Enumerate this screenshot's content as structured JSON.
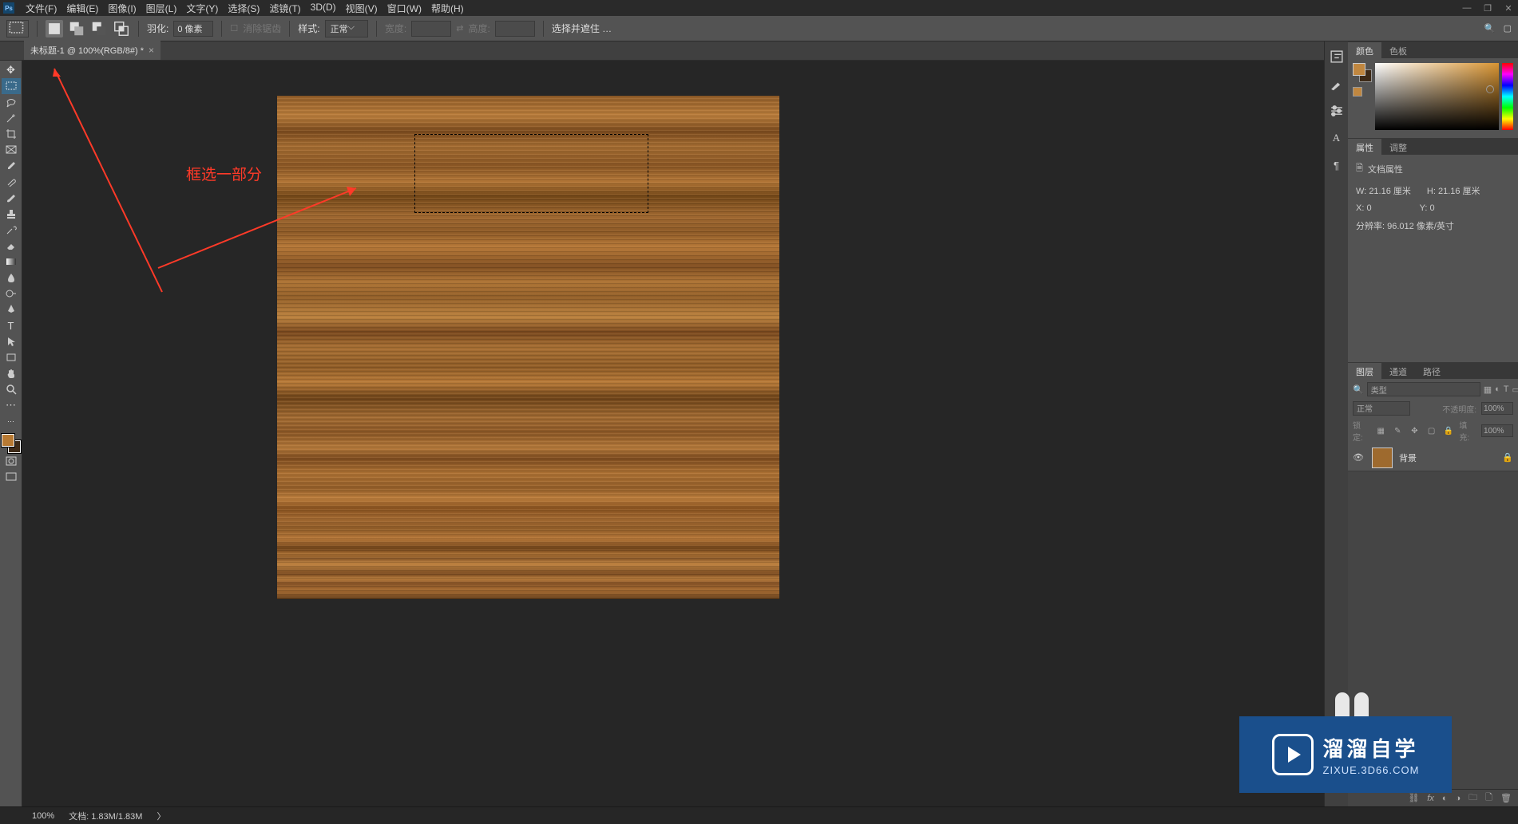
{
  "menu": {
    "file": "文件(F)",
    "edit": "编辑(E)",
    "image": "图像(I)",
    "layer": "图层(L)",
    "type": "文字(Y)",
    "select": "选择(S)",
    "filter": "滤镜(T)",
    "3d": "3D(D)",
    "view": "视图(V)",
    "window": "窗口(W)",
    "help": "帮助(H)"
  },
  "options": {
    "feather_label": "羽化:",
    "feather_value": "0 像素",
    "antialias_label": "消除锯齿",
    "style_label": "样式:",
    "style_value": "正常",
    "width_label": "宽度:",
    "height_label": "高度:",
    "select_mask": "选择并遮住 …"
  },
  "doc_tab": {
    "label": "未标题-1 @ 100%(RGB/8#) *"
  },
  "annotation": {
    "text": "框选一部分"
  },
  "panels": {
    "color_tab": "颜色",
    "swatches_tab": "色板",
    "properties_tab": "属性",
    "adjust_tab": "调整",
    "doc_props_title": "文档属性",
    "width_label": "W:",
    "width_value": "21.16 厘米",
    "height_label": "H:",
    "height_value": "21.16 厘米",
    "x_label": "X:",
    "x_value": "0",
    "y_label": "Y:",
    "y_value": "0",
    "resolution_label": "分辨率:",
    "resolution_value": "96.012 像素/英寸",
    "layers_tab": "图层",
    "channels_tab": "通道",
    "paths_tab": "路径",
    "search_placeholder": "类型",
    "blend_mode": "正常",
    "opacity_label": "不透明度:",
    "opacity_value": "100%",
    "lock_label": "锁定:",
    "fill_label": "填充:",
    "fill_value": "100%",
    "layer_name": "背景"
  },
  "status": {
    "zoom": "100%",
    "doc_size": "文档: 1.83M/1.83M"
  },
  "watermark": {
    "title": "溜溜自学",
    "url": "ZIXUE.3D66.COM"
  }
}
